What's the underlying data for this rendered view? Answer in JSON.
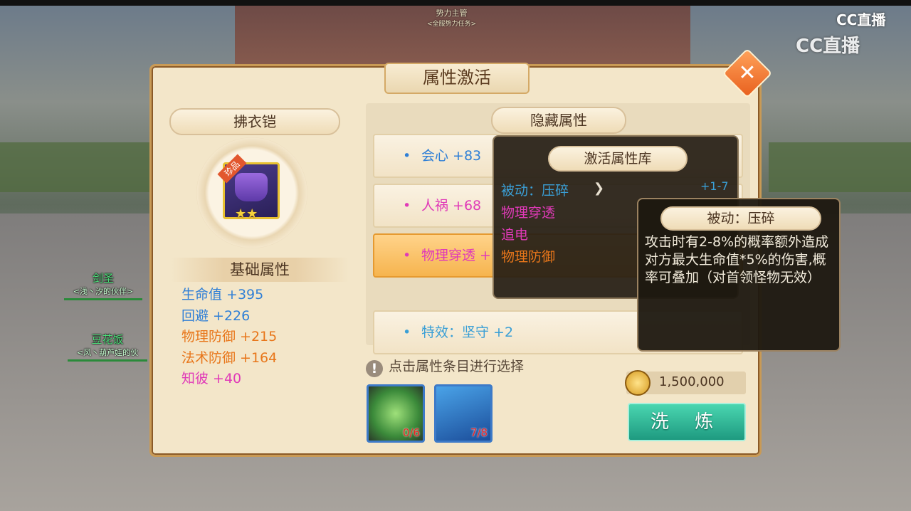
{
  "hud": {
    "top_npc_name": "势力主管",
    "top_npc_sub": "<全服势力任务>",
    "watermark_1": "CC直播",
    "watermark_2": "CC直播"
  },
  "npcs": [
    {
      "name": "剑圣",
      "sub": "<浅丶汐的伙伴>"
    },
    {
      "name": "豆花饭",
      "sub": "<风丶葫芦娃的伙"
    }
  ],
  "dialog": {
    "title": "属性激活",
    "close_icon": "close-icon"
  },
  "item": {
    "name": "拂衣铠",
    "rarity": "珍品",
    "stars": "★★",
    "icon": "armor-icon"
  },
  "base_attrs": {
    "title": "基础属性",
    "rows": [
      {
        "label": "生命值 +395",
        "color": "#2f7fd6"
      },
      {
        "label": "回避 +226",
        "color": "#2f7fd6"
      },
      {
        "label": "物理防御 +215",
        "color": "#e8761a"
      },
      {
        "label": "法术防御 +164",
        "color": "#e8761a"
      },
      {
        "label": "知彼 +40",
        "color": "#e03ab8"
      }
    ]
  },
  "hidden_attrs": {
    "title": "隐藏属性",
    "rows": [
      {
        "label": "会心 +83",
        "color": "#2f7fd6",
        "selected": false
      },
      {
        "label": "人祸 +68",
        "color": "#e03ab8",
        "selected": false
      },
      {
        "label": "物理穿透 +",
        "color": "#e03ab8",
        "selected": true
      },
      {
        "label": "特效：坚守 +2",
        "color": "#3a9fd6",
        "selected": false
      }
    ]
  },
  "hint": {
    "icon": "exclamation-icon",
    "text": "点击属性条目进行选择"
  },
  "materials": [
    {
      "icon": "green-orb-icon",
      "count": "0/6"
    },
    {
      "icon": "blue-scroll-icon",
      "count": "7/8"
    }
  ],
  "cost": {
    "icon": "coin-icon",
    "value": "1,500,000"
  },
  "refine_button": "洗 炼",
  "library_popup": {
    "title": "激活属性库",
    "items": [
      {
        "label": "被动：压碎",
        "color": "#3a9fd6"
      },
      {
        "label": "物理穿透",
        "color": "#e03ab8"
      },
      {
        "label": "追电",
        "color": "#e03ab8"
      },
      {
        "label": "物理防御",
        "color": "#e8761a"
      }
    ],
    "range": "+1-7"
  },
  "tooltip": {
    "title": "被动：压碎",
    "text": "攻击时有2-8%的概率额外造成对方最大生命值*5%的伤害,概率可叠加（对首领怪物无效）"
  }
}
